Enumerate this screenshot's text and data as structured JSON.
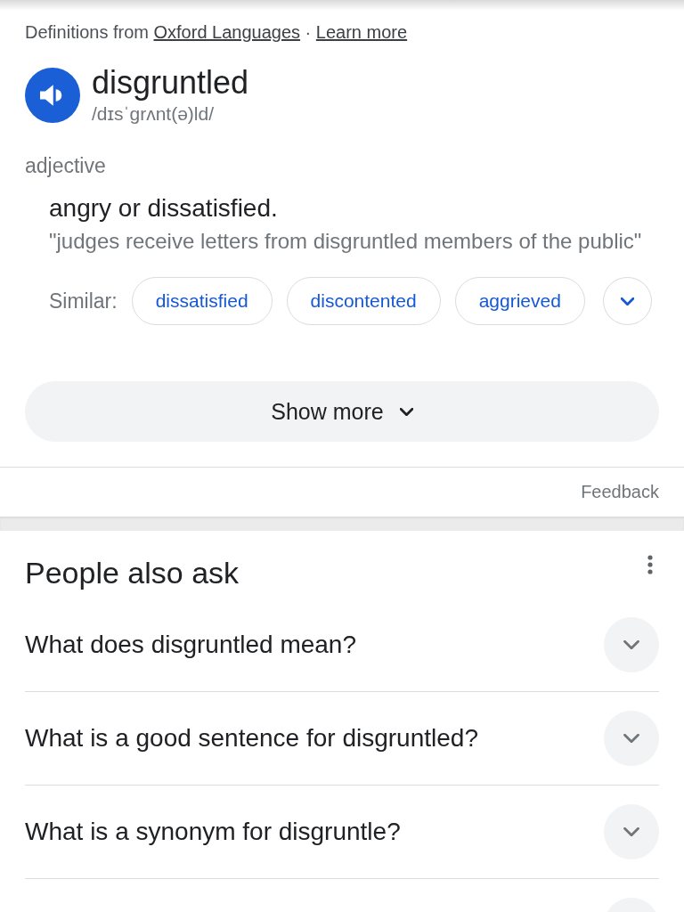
{
  "attribution": {
    "prefix": "Definitions from",
    "source": "Oxford Languages",
    "separator": "·",
    "link": "Learn more"
  },
  "entry": {
    "word": "disgruntled",
    "pronunciation": "/dɪsˈgrʌnt(ə)ld/",
    "part_of_speech": "adjective",
    "senses": [
      {
        "definition": "angry or dissatisfied.",
        "example": "\"judges receive letters from disgruntled members of the public\"",
        "similar_label": "Similar:",
        "similar": [
          "dissatisfied",
          "discontented",
          "aggrieved"
        ]
      }
    ]
  },
  "show_more": "Show more",
  "feedback": "Feedback",
  "people_also_ask": {
    "title": "People also ask",
    "questions": [
      {
        "text": "What does disgruntled mean?",
        "expanded": false
      },
      {
        "text": "What is a good sentence for disgruntled?",
        "expanded": false
      },
      {
        "text": "What is a synonym for disgruntle?",
        "expanded": false
      },
      {
        "expanded": false
      }
    ]
  }
}
